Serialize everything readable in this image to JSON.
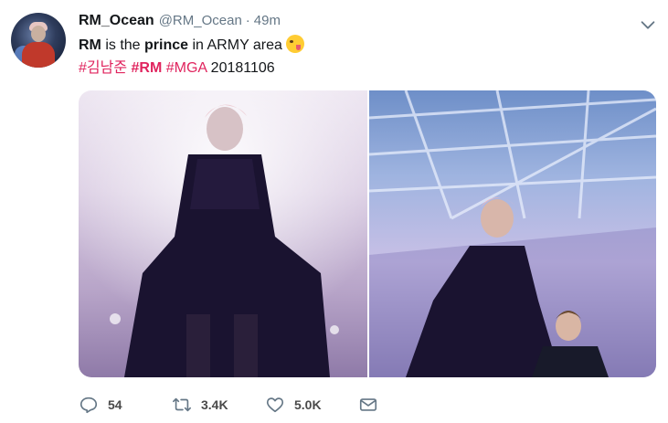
{
  "tweet": {
    "display_name": "RM_Ocean",
    "handle": "@RM_Ocean",
    "separator": "·",
    "time": "49m",
    "text": {
      "part1": "RM",
      "part2": " is the ",
      "part3": "prince",
      "part4": " in ARMY area"
    },
    "hashtags": {
      "tag1": "#김남준",
      "tag2": "#RM",
      "tag3": "#MGA",
      "trailing": "20181106"
    },
    "actions": {
      "replies": "54",
      "retweets": "3.4K",
      "likes": "5.0K"
    }
  },
  "colors": {
    "hashtag": "#e0245e",
    "secondary_text": "#657786",
    "icon": "#657786"
  },
  "icons": {
    "menu": "chevron-down-icon",
    "reply": "reply-icon",
    "retweet": "retweet-icon",
    "like": "heart-icon",
    "message": "envelope-icon",
    "emoji": "tongue-wink-emoji"
  }
}
